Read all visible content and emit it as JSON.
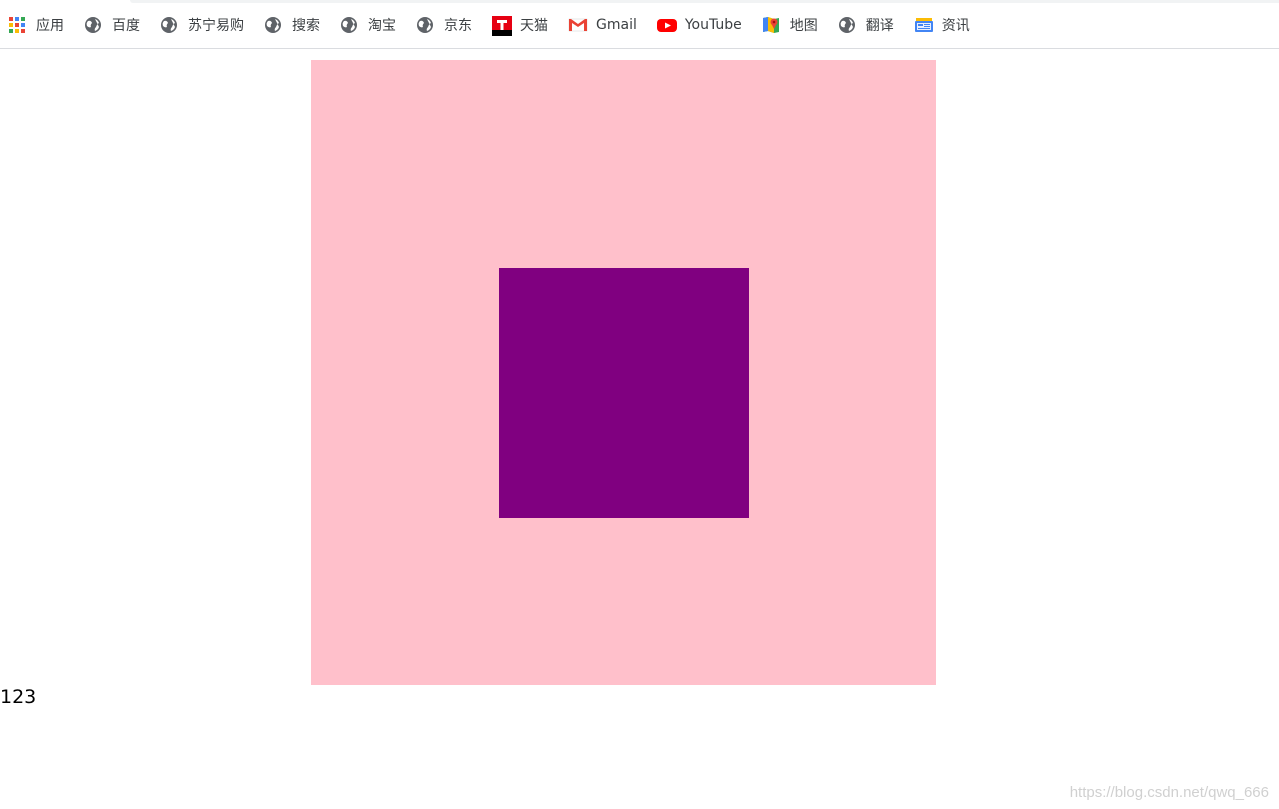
{
  "bookmarks": [
    {
      "label": "应用",
      "icon": "apps-grid-icon"
    },
    {
      "label": "百度",
      "icon": "globe-icon"
    },
    {
      "label": "苏宁易购",
      "icon": "globe-icon"
    },
    {
      "label": "搜索",
      "icon": "globe-icon"
    },
    {
      "label": "淘宝",
      "icon": "globe-icon"
    },
    {
      "label": "京东",
      "icon": "globe-icon"
    },
    {
      "label": "天猫",
      "icon": "tmall-icon"
    },
    {
      "label": "Gmail",
      "icon": "gmail-icon"
    },
    {
      "label": "YouTube",
      "icon": "youtube-icon"
    },
    {
      "label": "地图",
      "icon": "maps-icon"
    },
    {
      "label": "翻译",
      "icon": "globe-icon"
    },
    {
      "label": "资讯",
      "icon": "news-icon"
    }
  ],
  "page": {
    "outer_box_color": "#ffc0cb",
    "inner_box_color": "#800080",
    "body_text": "123",
    "watermark": "https://blog.csdn.net/qwq_666"
  }
}
